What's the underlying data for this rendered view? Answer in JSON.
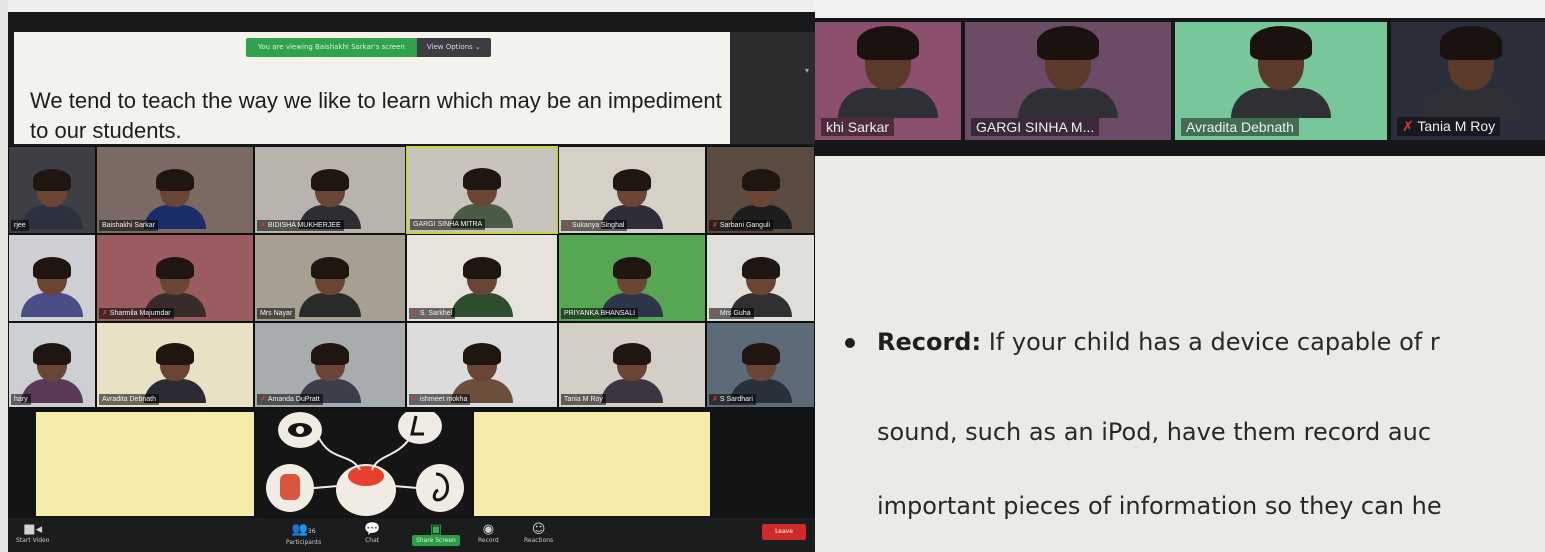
{
  "left_screen": {
    "share_banner": {
      "sharing_label": "You are viewing Baishakhi Sarkar's screen",
      "view_options": "View Options ⌄"
    },
    "slide_text": "We tend to teach the way we like to learn which may be an impediment to our students.",
    "participants": [
      {
        "name": "rjee",
        "muted": false
      },
      {
        "name": "Baishakhi Sarkar",
        "muted": false
      },
      {
        "name": "BIDISHA MUKHERJEE",
        "muted": true
      },
      {
        "name": "GARGI SINHA MITRA",
        "muted": false,
        "active": true
      },
      {
        "name": "Sukanya Singhal",
        "muted": true
      },
      {
        "name": "Sarbani Ganguli",
        "muted": true
      },
      {
        "name": "",
        "muted": false
      },
      {
        "name": "Sharmila Majumdar",
        "muted": true
      },
      {
        "name": "Mrs Nayar",
        "muted": false
      },
      {
        "name": "S. Sarkhel",
        "muted": true
      },
      {
        "name": "PRIYANKA BHANSALI",
        "muted": false
      },
      {
        "name": "Mrs Guha",
        "muted": true
      },
      {
        "name": "hary",
        "muted": false
      },
      {
        "name": "Avradita Debnath",
        "muted": false
      },
      {
        "name": "Amanda DuPratt",
        "muted": true
      },
      {
        "name": "ishmeet mokha",
        "muted": true
      },
      {
        "name": "Tania M Roy",
        "muted": false
      },
      {
        "name": "S Sardhari",
        "muted": true
      }
    ],
    "toolbar": {
      "video": "Start Video",
      "participants_label": "Participants",
      "participants_count": "36",
      "chat": "Chat",
      "share": "Share Screen",
      "record": "Record",
      "reactions": "Reactions",
      "end": "Leave"
    }
  },
  "right_screen": {
    "strip": [
      {
        "name": "khi Sarkar",
        "muted": false
      },
      {
        "name": "GARGI SINHA M...",
        "muted": false
      },
      {
        "name": "Avradita Debnath",
        "muted": false
      },
      {
        "name": "Tania M Roy",
        "muted": true
      }
    ],
    "slide": {
      "bold": "Record:",
      "line1": " If your child has a device capable of r",
      "line2": "sound, such as an iPod, have them record auc",
      "line3": "important pieces of information so they can he"
    }
  },
  "colors": {
    "zoom_green": "#31a24c",
    "end_red": "#d12a2a",
    "active_speaker": "#c7d33a",
    "mute_red": "#e33333"
  }
}
